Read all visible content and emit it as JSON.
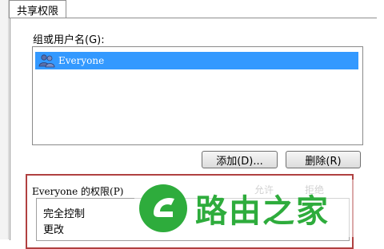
{
  "tab": {
    "label": "共享权限"
  },
  "group": {
    "label": "组或用户名(G):",
    "items": [
      {
        "name": "Everyone",
        "icon": "users-icon",
        "selected": true
      }
    ]
  },
  "buttons": {
    "add": "添加(D)...",
    "remove": "删除(R)"
  },
  "permissions": {
    "title": "Everyone 的权限(P)",
    "columns": {
      "allow": "允许",
      "deny": "拒绝"
    },
    "rows": [
      {
        "name": "完全控制"
      },
      {
        "name": "更改"
      }
    ]
  },
  "watermark": {
    "text": "路由之家",
    "icon": "luyou-logo-icon",
    "color": "#2eac3c"
  },
  "colors": {
    "selection": "#3399ff",
    "highlight_border": "#b04040"
  }
}
